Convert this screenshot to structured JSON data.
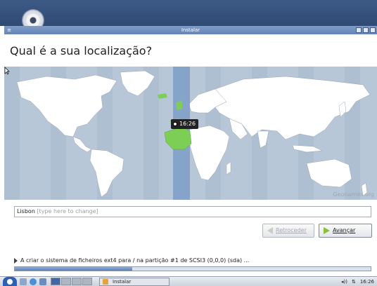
{
  "window": {
    "title": "Instalar"
  },
  "heading": "Qual é a sua localização?",
  "map": {
    "tooltip_time": "16:26",
    "credit": "Geonames.org"
  },
  "location": {
    "value": "Lisbon",
    "hint": "[type here to change]"
  },
  "buttons": {
    "back": "Retroceder",
    "forward": "Avançar"
  },
  "status": {
    "text": "A criar o sistema de ficheiros ext4 para / na partição #1 de SCSI3 (0,0,0) (sda) ...",
    "progress": 0.33
  },
  "taskbar": {
    "task_label": "Instalar",
    "clock": "16:26"
  },
  "colors": {
    "accent": "#6585b6",
    "timezone_highlight": "#7d9cc8",
    "selected_region": "#7ccf54"
  }
}
